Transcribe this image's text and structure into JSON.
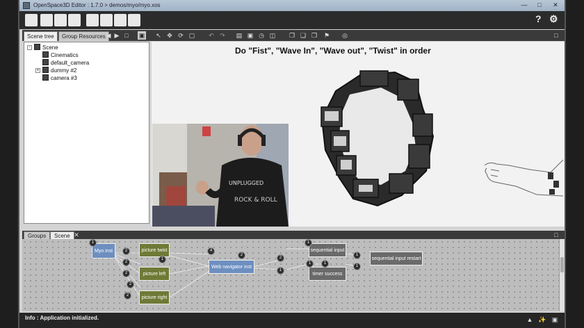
{
  "window": {
    "title": "OpenSpace3D Editor : 1.7.0 > demos/myo/myo.xos"
  },
  "toolbar": {
    "left_icons": [
      "new-icon",
      "open-icon",
      "save-icon",
      "save-as-icon",
      "add-icon",
      "table-icon",
      "plugin-icon",
      "play-icon"
    ],
    "right_icons": [
      "help-icon",
      "settings-icon"
    ]
  },
  "scene_tabs": [
    {
      "label": "Scene tree",
      "active": true
    },
    {
      "label": "Group Resources",
      "active": false
    }
  ],
  "scene_tree": {
    "root": "Scene",
    "children": [
      {
        "label": "Cinematics",
        "expandable": false
      },
      {
        "label": "default_camera",
        "expandable": false
      },
      {
        "label": "dummy #2",
        "expandable": true
      },
      {
        "label": "camera #3",
        "expandable": false
      }
    ]
  },
  "viewport": {
    "heading": "Do \"Fist\", \"Wave In\", \"Wave out\", \"Twist\" in order"
  },
  "bottom_tabs": [
    {
      "label": "Groups",
      "active": false
    },
    {
      "label": "Scene",
      "active": true
    }
  ],
  "graph": {
    "nodes": [
      {
        "id": "n1",
        "label": "Myo inst",
        "color": "blue"
      },
      {
        "id": "n2",
        "label": "picture twist",
        "color": "olive"
      },
      {
        "id": "n3",
        "label": "picture left",
        "color": "olive"
      },
      {
        "id": "n4",
        "label": "picture right",
        "color": "olive"
      },
      {
        "id": "n5",
        "label": "Web navigator inst",
        "color": "blue"
      },
      {
        "id": "n6",
        "label": "sequential input",
        "color": "grey"
      },
      {
        "id": "n7",
        "label": "timer success",
        "color": "grey"
      },
      {
        "id": "n8",
        "label": "sequential input restart",
        "color": "grey"
      }
    ],
    "ports": [
      "1",
      "2",
      "2",
      "2",
      "2",
      "2",
      "4",
      "2",
      "1",
      "2",
      "1",
      "1",
      "1",
      "1",
      "1",
      "1"
    ]
  },
  "status": {
    "text": "Info : Application initialized."
  }
}
